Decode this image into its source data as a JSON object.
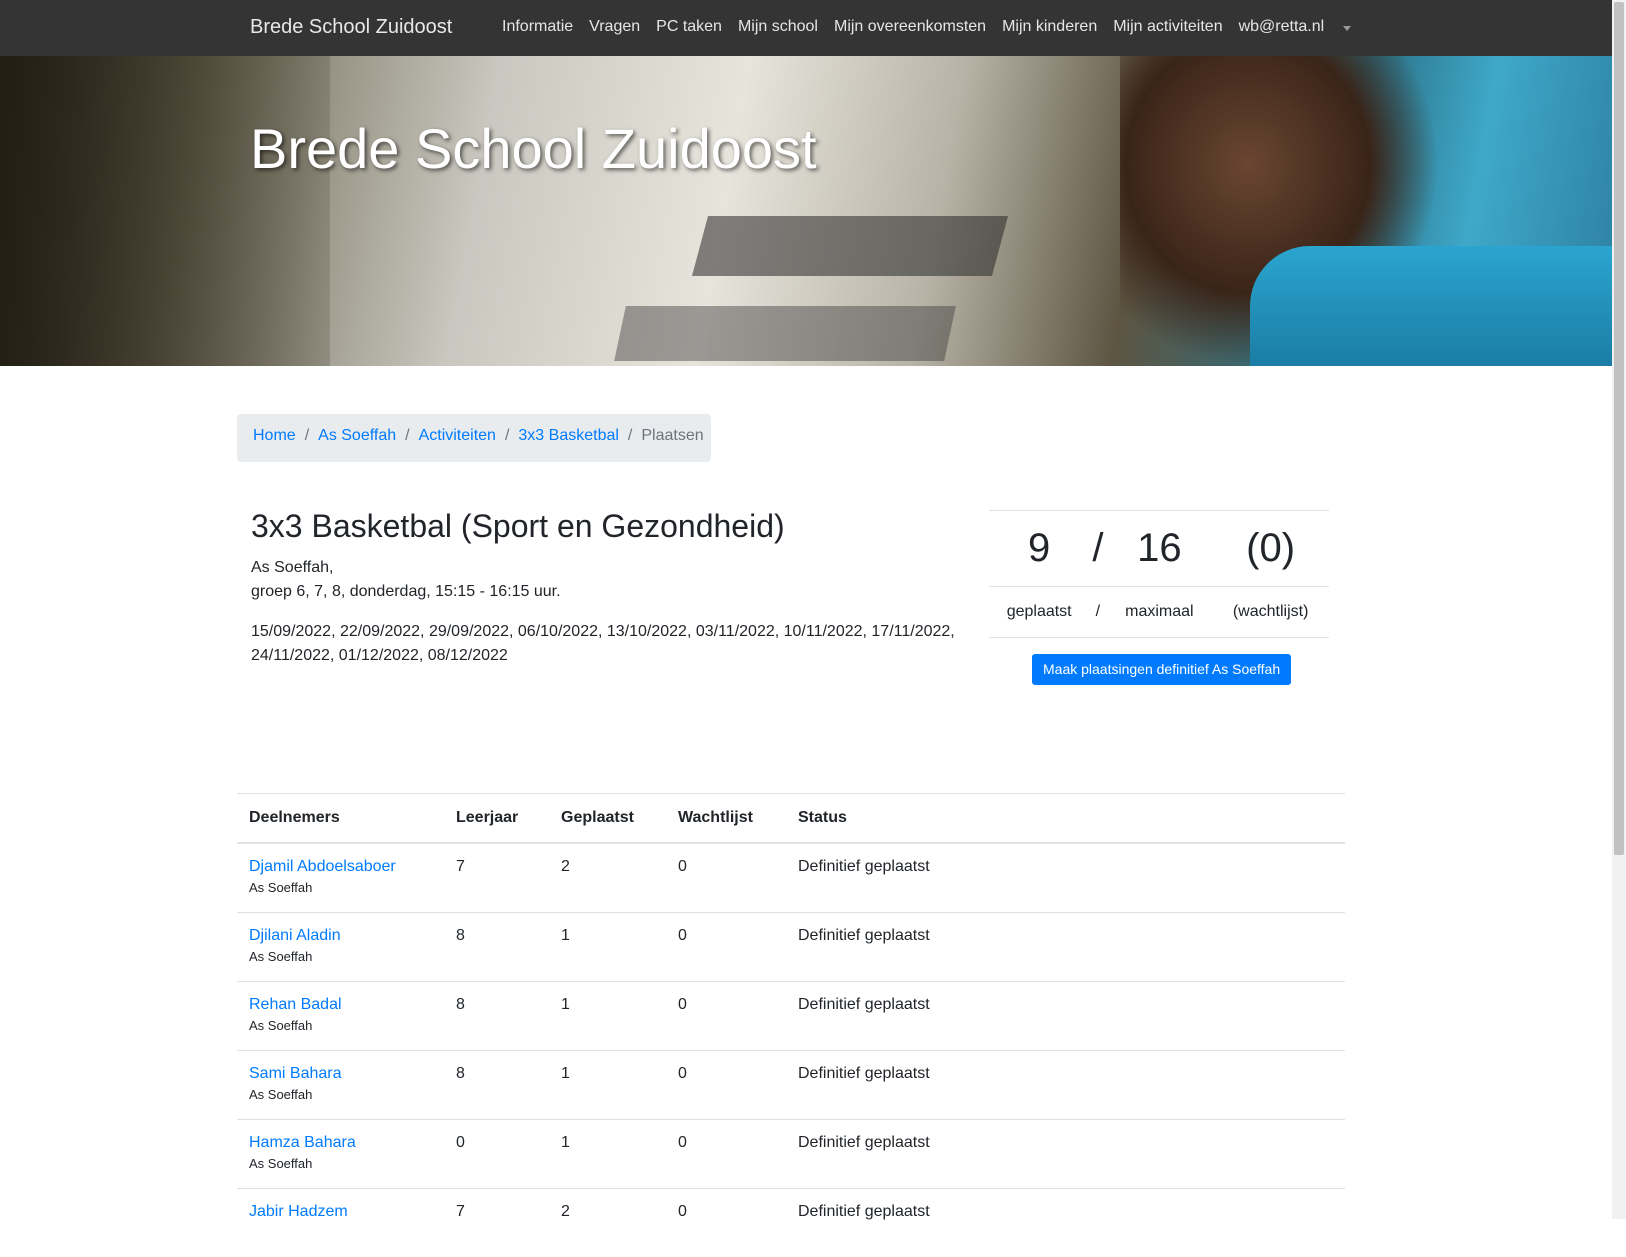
{
  "navbar": {
    "brand": "Brede School Zuidoost",
    "items": [
      {
        "label": "Informatie"
      },
      {
        "label": "Vragen"
      },
      {
        "label": "PC taken"
      },
      {
        "label": "Mijn school"
      },
      {
        "label": "Mijn overeenkomsten"
      },
      {
        "label": "Mijn kinderen"
      },
      {
        "label": "Mijn activiteiten"
      },
      {
        "label": "wb@retta.nl"
      }
    ]
  },
  "hero": {
    "title": "Brede School Zuidoost"
  },
  "breadcrumb": {
    "items": [
      {
        "label": "Home"
      },
      {
        "label": "As Soeffah"
      },
      {
        "label": "Activiteiten"
      },
      {
        "label": "3x3 Basketbal"
      }
    ],
    "separator": "/",
    "active": "Plaatsen"
  },
  "activity": {
    "title": "3x3 Basketbal (Sport en Gezondheid)",
    "school": "As Soeffah,",
    "schedule": "groep 6, 7, 8, donderdag, 15:15 - 16:15 uur.",
    "dates": "15/09/2022, 22/09/2022, 29/09/2022, 06/10/2022, 13/10/2022, 03/11/2022, 10/11/2022, 17/11/2022, 24/11/2022, 01/12/2022, 08/12/2022"
  },
  "stats": {
    "placed": "9",
    "sep": "/",
    "max": "16",
    "waitlist": "(0)",
    "placed_label": "geplaatst",
    "max_label": "maximaal",
    "waitlist_label": "(wachtlijst)"
  },
  "finalize_button": "Maak plaatsingen definitief As Soeffah",
  "table": {
    "headers": [
      "Deelnemers",
      "Leerjaar",
      "Geplaatst",
      "Wachtlijst",
      "Status"
    ],
    "rows": [
      {
        "name": "Djamil Abdoelsaboer",
        "school": "As Soeffah",
        "grade": "7",
        "placed": "2",
        "waitlist": "0",
        "status": "Definitief geplaatst"
      },
      {
        "name": "Djilani Aladin",
        "school": "As Soeffah",
        "grade": "8",
        "placed": "1",
        "waitlist": "0",
        "status": "Definitief geplaatst"
      },
      {
        "name": "Rehan Badal",
        "school": "As Soeffah",
        "grade": "8",
        "placed": "1",
        "waitlist": "0",
        "status": "Definitief geplaatst"
      },
      {
        "name": "Sami Bahara",
        "school": "As Soeffah",
        "grade": "8",
        "placed": "1",
        "waitlist": "0",
        "status": "Definitief geplaatst"
      },
      {
        "name": "Hamza Bahara",
        "school": "As Soeffah",
        "grade": "0",
        "placed": "1",
        "waitlist": "0",
        "status": "Definitief geplaatst"
      },
      {
        "name": "Jabir Hadzem",
        "school": "",
        "grade": "7",
        "placed": "2",
        "waitlist": "0",
        "status": "Definitief geplaatst"
      }
    ]
  }
}
